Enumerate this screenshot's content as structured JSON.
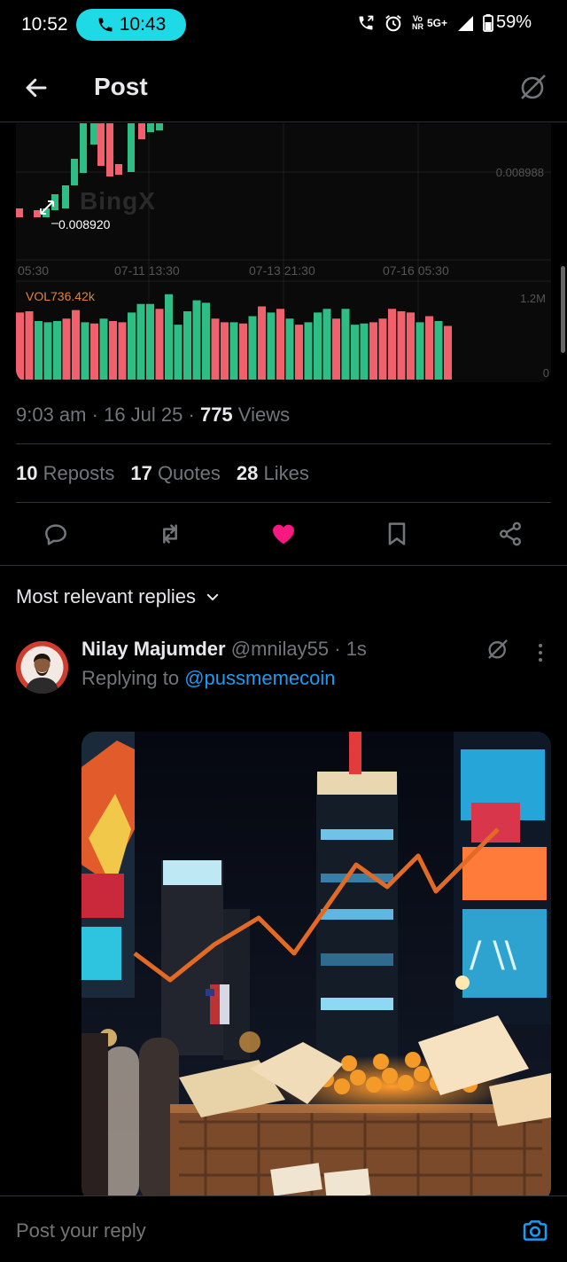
{
  "status": {
    "time": "10:52",
    "call_time": "10:43",
    "net_top": "Vo",
    "net_bottom": "NR",
    "net_gen": "5G+",
    "battery": "59%"
  },
  "header": {
    "title": "Post"
  },
  "chart": {
    "watermark": "BingX",
    "price_label": "0.008920",
    "price_right": "0.008988",
    "x_ticks": [
      "05:30",
      "07-11 13:30",
      "07-13 21:30",
      "07-16 05:30"
    ],
    "vol_label": "VOL736.42k",
    "vol_top": "1.2M",
    "vol_zero": "0",
    "colors": {
      "up": "#2ebd85",
      "down": "#f0616d"
    }
  },
  "chart_data": {
    "type": "bar",
    "title": "",
    "series": [
      {
        "name": "",
        "values": [
          0.55,
          0.56,
          0.48,
          0.47,
          0.48,
          0.5,
          0.57,
          0.47,
          0.46,
          0.5,
          0.48,
          0.47,
          0.55,
          0.62,
          0.62,
          0.58,
          0.7,
          0.45,
          0.56,
          0.65,
          0.63,
          0.5,
          0.47,
          0.47,
          0.46,
          0.52,
          0.6,
          0.55,
          0.58,
          0.5,
          0.45,
          0.47,
          0.55,
          0.58,
          0.5,
          0.58,
          0.45,
          0.46,
          0.47,
          0.5,
          0.58,
          0.56,
          0.55,
          0.47,
          0.52,
          0.48,
          0.44
        ],
        "colors_up": [
          false,
          false,
          true,
          true,
          true,
          false,
          false,
          true,
          false,
          true,
          false,
          false,
          true,
          true,
          true,
          false,
          true,
          true,
          true,
          true,
          true,
          false,
          false,
          true,
          false,
          true,
          false,
          true,
          false,
          true,
          false,
          true,
          true,
          true,
          false,
          true,
          true,
          true,
          false,
          false,
          false,
          false,
          false,
          true,
          false,
          true,
          false
        ]
      }
    ],
    "ylim": [
      0,
      1.2
    ],
    "ylabel": "",
    "xlabel": ""
  },
  "meta": {
    "time": "9:03 am",
    "date": "16 Jul 25",
    "views": "775",
    "views_label": "Views",
    "dot": "·"
  },
  "stats": {
    "reposts": "10",
    "reposts_label": "Reposts",
    "quotes": "17",
    "quotes_label": "Quotes",
    "likes": "28",
    "likes_label": "Likes"
  },
  "replies": {
    "sort_label": "Most relevant replies"
  },
  "reply": {
    "name": "Nilay Majumder",
    "handle": "@mnilay55",
    "time": "· 1s",
    "replying_prefix": "Replying to",
    "replying_to": "@pussmemecoin"
  },
  "compose": {
    "placeholder": "Post your reply"
  }
}
